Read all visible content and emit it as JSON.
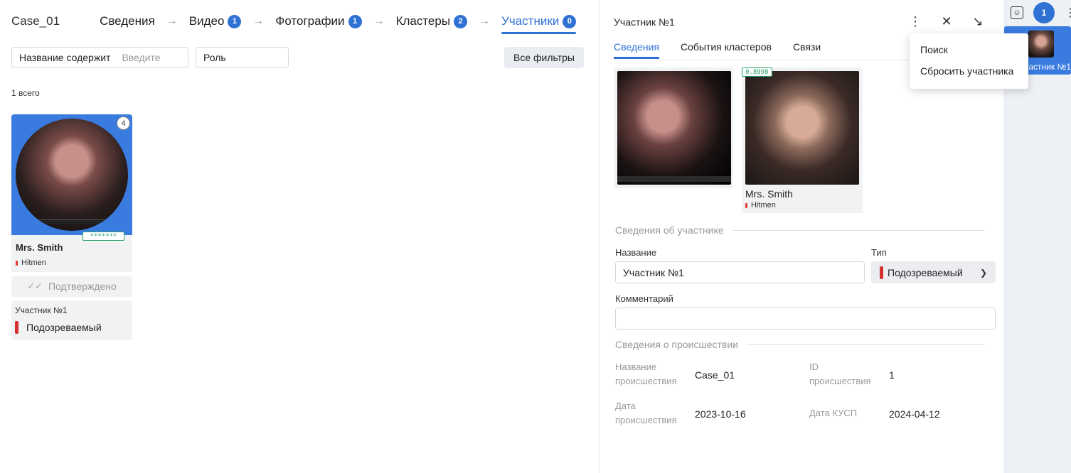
{
  "header": {
    "case_title": "Case_01",
    "steps": [
      {
        "label": "Сведения",
        "badge": null
      },
      {
        "label": "Видео",
        "badge": "1"
      },
      {
        "label": "Фотографии",
        "badge": "1"
      },
      {
        "label": "Кластеры",
        "badge": "2"
      },
      {
        "label": "Участники",
        "badge": "0"
      }
    ],
    "arrow": "→"
  },
  "filters": {
    "name_label": "Название содержит",
    "name_placeholder": "Введите",
    "role_label": "Роль",
    "all_filters": "Все фильтры"
  },
  "list": {
    "count": "1 всего",
    "card": {
      "badge": "4",
      "mask": "*******",
      "name": "Mrs. Smith",
      "group": "Hitmen",
      "confirmed": "Подтверждено",
      "participant": "Участник №1",
      "role": "Подозреваемый"
    }
  },
  "detail": {
    "title": "Участник №1",
    "tabs": [
      "Сведения",
      "События кластеров",
      "Связи"
    ],
    "score": "0.8998",
    "photo_name": "Mrs. Smith",
    "photo_group": "Hitmen",
    "section_participant": "Сведения об участнике",
    "name_label": "Название",
    "name_value": "Участник №1",
    "type_label": "Тип",
    "type_value": "Подозреваемый",
    "comment_label": "Комментарий",
    "comment_value": "",
    "section_incident": "Сведения о происшествии",
    "incident": {
      "name_key": "Название происшествия",
      "name_val": "Case_01",
      "id_key": "ID происшествия",
      "id_val": "1",
      "date_key": "Дата происшествия",
      "date_val": "2023-10-16",
      "kusp_key": "Дата КУСП",
      "kusp_val": "2024-04-12"
    }
  },
  "menu": {
    "items": [
      "Поиск",
      "Сбросить участника"
    ]
  },
  "strip": {
    "count": "1",
    "item_label": "астник №1"
  },
  "colors": {
    "accent": "#2f72d4",
    "card_bg": "#3a7be0",
    "role_red": "#d32f2f",
    "score_green": "#2aa06a"
  }
}
